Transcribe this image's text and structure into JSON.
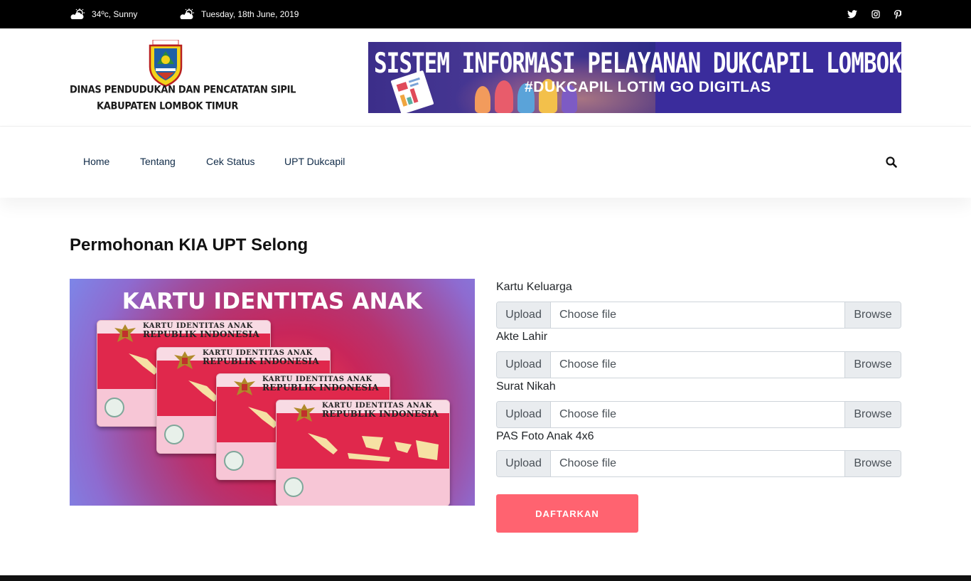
{
  "topbar": {
    "weather": "34ºc, Sunny",
    "date": "Tuesday, 18th June, 2019",
    "weather_icon": "cloud-sun-icon",
    "social_icons": [
      "twitter-icon",
      "instagram-icon",
      "pinterest-icon"
    ]
  },
  "header": {
    "logo_line1": "DINAS PENDUDUKAN DAN PENCATATAN SIPIL",
    "logo_line2": "KABUPATEN LOMBOK TIMUR",
    "crest_text": "LOMBOK TIMUR",
    "banner_title": "SISTEM INFORMASI PELAYANAN DUKCAPIL LOMBOK TIMUR",
    "banner_subtitle": "#DUKCAPIL LOTIM GO DIGITLAS"
  },
  "nav": {
    "items": [
      {
        "label": "Home"
      },
      {
        "label": "Tentang"
      },
      {
        "label": "Cek Status"
      },
      {
        "label": "UPT Dukcapil"
      }
    ],
    "search_icon": "search-icon"
  },
  "main": {
    "title": "Permohonan KIA UPT Selong",
    "image": {
      "title": "KARTU IDENTITAS ANAK",
      "card_line1": "KARTU IDENTITAS ANAK",
      "card_line2": "REPUBLIK INDONESIA"
    },
    "form": {
      "fields": [
        {
          "label": "Kartu Keluarga",
          "prefix": "Upload",
          "placeholder": "Choose file",
          "browse": "Browse"
        },
        {
          "label": "Akte Lahir",
          "prefix": "Upload",
          "placeholder": "Choose file",
          "browse": "Browse"
        },
        {
          "label": "Surat Nikah",
          "prefix": "Upload",
          "placeholder": "Choose file",
          "browse": "Browse"
        },
        {
          "label": "PAS Foto Anak 4x6",
          "prefix": "Upload",
          "placeholder": "Choose file",
          "browse": "Browse"
        }
      ],
      "submit_label": "DAFTARKAN"
    }
  },
  "colors": {
    "topbar_bg": "#000000",
    "nav_text": "#0f2a47",
    "submit_bg": "#ff6370",
    "input_addon_bg": "#e9ecef"
  }
}
